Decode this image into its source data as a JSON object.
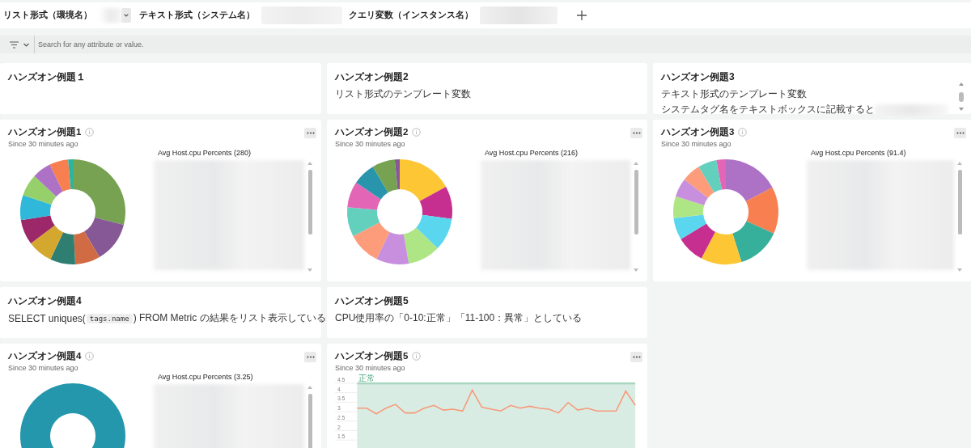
{
  "top_bar": {
    "variables": [
      {
        "label": "リスト形式（環境名）",
        "kind": "dropdown"
      },
      {
        "label": "テキスト形式（システム名）",
        "kind": "text"
      },
      {
        "label": "クエリ変数（インスタンス名）",
        "kind": "text"
      }
    ]
  },
  "filter_bar": {
    "placeholder": "Search for any attribute or value."
  },
  "columns": [
    {
      "widgets": [
        {
          "kind": "markdown",
          "heading": "ハンズオン例題１"
        },
        {
          "kind": "donut",
          "title": "ハンズオン例題1",
          "subtitle": "Since 30 minutes ago",
          "legend_title": "Avg Host.cpu Percents (280)"
        },
        {
          "kind": "markdown",
          "heading": "ハンズオン例題4",
          "lines": [
            {
              "parts": [
                {
                  "kind": "text",
                  "text": "SELECT uniques("
                },
                {
                  "kind": "code",
                  "text": "tags.name"
                },
                {
                  "kind": "text",
                  "text": ") FROM Metric の結果をリスト表示している"
                }
              ]
            }
          ]
        },
        {
          "kind": "donut",
          "title": "ハンズオン例題4",
          "subtitle": "Since 30 minutes ago",
          "legend_title": "Avg Host.cpu Percents (3.25)"
        }
      ]
    },
    {
      "widgets": [
        {
          "kind": "markdown",
          "heading": "ハンズオン例題2",
          "lines": [
            {
              "parts": [
                {
                  "kind": "text",
                  "text": "リスト形式のテンプレート変数"
                }
              ]
            }
          ]
        },
        {
          "kind": "donut",
          "title": "ハンズオン例題2",
          "subtitle": "Since 30 minutes ago",
          "legend_title": "Avg Host.cpu Percents (216)"
        },
        {
          "kind": "markdown",
          "heading": "ハンズオン例題5",
          "lines": [
            {
              "parts": [
                {
                  "kind": "text",
                  "text": "CPU使用率の「0-10:正常」「11-100：異常」としている"
                }
              ]
            }
          ]
        },
        {
          "kind": "line",
          "title": "ハンズオン例題5",
          "subtitle": "Since 30 minutes ago",
          "chart_data": {
            "type": "line",
            "ylim": [
              0.75,
              4.5
            ],
            "yticks": [
              1.5,
              2,
              2.5,
              3,
              3.5,
              4,
              4.5
            ],
            "series": [
              {
                "color": "#f79a78",
                "values": [
                  3.1,
                  3.1,
                  2.8,
                  3.1,
                  3.3,
                  2.85,
                  2.85,
                  3.1,
                  3.25,
                  3.0,
                  3.05,
                  2.95,
                  4.05,
                  3.15,
                  3.05,
                  2.95,
                  3.25,
                  3.1,
                  3.2,
                  3.1,
                  3.05,
                  2.85,
                  3.4,
                  3.0,
                  3.1,
                  2.95,
                  2.95,
                  2.95,
                  4.0,
                  3.25
                ]
              }
            ],
            "annotations": [
              {
                "text": "正常"
              }
            ]
          }
        }
      ]
    },
    {
      "widgets": [
        {
          "kind": "markdown",
          "heading": "ハンズオン例題3",
          "lines": [
            {
              "parts": [
                {
                  "kind": "text",
                  "text": "テキスト形式のテンプレート変数"
                }
              ]
            },
            {
              "parts": [
                {
                  "kind": "text",
                  "text": "システムタグ名をテキストボックスに記載すると"
                }
              ],
              "blurred": true
            }
          ]
        },
        {
          "kind": "donut",
          "title": "ハンズオン例題3",
          "subtitle": "Since 30 minutes ago",
          "legend_title": "Avg Host.cpu Percents (91.4)"
        }
      ]
    }
  ]
}
